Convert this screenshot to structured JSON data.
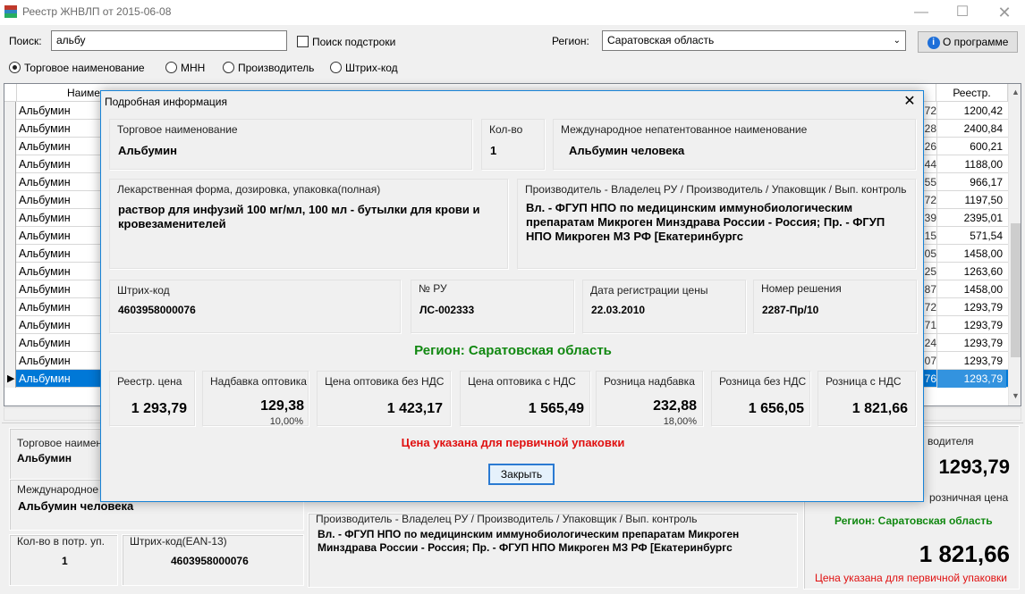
{
  "window": {
    "title": "Реестр ЖНВЛП от 2015-06-08"
  },
  "search": {
    "label": "Поиск:",
    "value": "альбу",
    "substring_label": "Поиск подстроки"
  },
  "region": {
    "label": "Регион:",
    "value": "Саратовская область"
  },
  "about_button": "О программе",
  "radio_options": [
    {
      "label": "Торговое наименование",
      "selected": true
    },
    {
      "label": "МНН",
      "selected": false
    },
    {
      "label": "Производитель",
      "selected": false
    },
    {
      "label": "Штрих-код",
      "selected": false
    }
  ],
  "grid": {
    "headers": {
      "name": "Наиме",
      "price": "Реестр."
    },
    "rows": [
      {
        "name": "Альбумин",
        "cut": "72",
        "price": "1200,42"
      },
      {
        "name": "Альбумин",
        "cut": "28",
        "price": "2400,84"
      },
      {
        "name": "Альбумин",
        "cut": "26",
        "price": "600,21"
      },
      {
        "name": "Альбумин",
        "cut": "44",
        "price": "1188,00"
      },
      {
        "name": "Альбумин",
        "cut": "55",
        "price": "966,17"
      },
      {
        "name": "Альбумин",
        "cut": "72",
        "price": "1197,50"
      },
      {
        "name": "Альбумин",
        "cut": "39",
        "price": "2395,01"
      },
      {
        "name": "Альбумин",
        "cut": "15",
        "price": "571,54"
      },
      {
        "name": "Альбумин",
        "cut": "05",
        "price": "1458,00"
      },
      {
        "name": "Альбумин",
        "cut": "25",
        "price": "1263,60"
      },
      {
        "name": "Альбумин",
        "cut": "87",
        "price": "1458,00"
      },
      {
        "name": "Альбумин",
        "cut": "72",
        "price": "1293,79"
      },
      {
        "name": "Альбумин",
        "cut": "71",
        "price": "1293,79"
      },
      {
        "name": "Альбумин",
        "cut": "24",
        "price": "1293,79"
      },
      {
        "name": "Альбумин",
        "cut": "07",
        "price": "1293,79"
      },
      {
        "name": "Альбумин",
        "cut": "76",
        "price": "1293,79",
        "selected": true
      }
    ]
  },
  "bottom": {
    "trade_name_label": "Торговое наимен",
    "trade_name_value": "Альбумин",
    "mnn_label": "Международное",
    "mnn_value": "Альбумин человека",
    "qty_label": "Кол-во в потр. уп.",
    "qty_value": "1",
    "barcode_label": "Штрих-код(EAN-13)",
    "barcode_value": "4603958000076",
    "manufacturer_label": "Производитель - Владелец РУ / Производитель / Упаковщик / Вып. контроль",
    "manufacturer_value": "Вл. - ФГУП НПО по медицинским иммунобиологическим препаратам Микроген Минздрава России - Россия; Пр. - ФГУП НПО Микроген МЗ РФ [Екатеринбургс",
    "producer_price_label": "водителя",
    "producer_price_value": "1293,79",
    "retail_label": "розничная цена",
    "region_text": "Регион: Саратовская область",
    "retail_value": "1 821,66",
    "note": "Цена указана для первичной упаковки"
  },
  "modal": {
    "title": "Подробная информация",
    "trade_name_label": "Торговое наименование",
    "trade_name_value": "Альбумин",
    "qty_label": "Кол-во",
    "qty_value": "1",
    "inn_label": "Международное непатентованное наименование",
    "inn_value": "Альбумин человека",
    "form_label": "Лекарственная форма, дозировка, упаковка(полная)",
    "form_value": "раствор для инфузий 100 мг/мл, 100 мл - бутылки для крови и кровезаменителей",
    "manufacturer_label": "Производитель - Владелец РУ / Производитель / Упаковщик / Вып. контроль",
    "manufacturer_value": "Вл. - ФГУП НПО по медицинским иммунобиологическим препаратам Микроген Минздрава России - Россия; Пр. - ФГУП НПО Микроген МЗ РФ [Екатеринбургс",
    "barcode_label": "Штрих-код",
    "barcode_value": "4603958000076",
    "ru_label": "№ РУ",
    "ru_value": "ЛС-002333",
    "price_date_label": "Дата регистрации цены",
    "price_date_value": "22.03.2010",
    "decision_label": "Номер решения",
    "decision_value": "2287-Пр/10",
    "region_text": "Регион: Саратовская область",
    "prices": [
      {
        "label": "Реестр. цена",
        "value": "1 293,79",
        "pct": ""
      },
      {
        "label": "Надбавка оптовика",
        "value": "129,38",
        "pct": "10,00%"
      },
      {
        "label": "Цена  оптовика без НДС",
        "value": "1 423,17",
        "pct": ""
      },
      {
        "label": "Цена оптовика с НДС",
        "value": "1 565,49",
        "pct": ""
      },
      {
        "label": "Розница надбавка",
        "value": "232,88",
        "pct": "18,00%"
      },
      {
        "label": "Розница без НДС",
        "value": "1 656,05",
        "pct": ""
      },
      {
        "label": "Розница с НДС",
        "value": "1 821,66",
        "pct": ""
      }
    ],
    "note": "Цена указана для первичной упаковки",
    "close_button": "Закрыть"
  },
  "colors": {
    "selection": "#0078d7",
    "accent_green": "#118811",
    "accent_red": "#e01010",
    "modal_border": "#1883d7"
  }
}
